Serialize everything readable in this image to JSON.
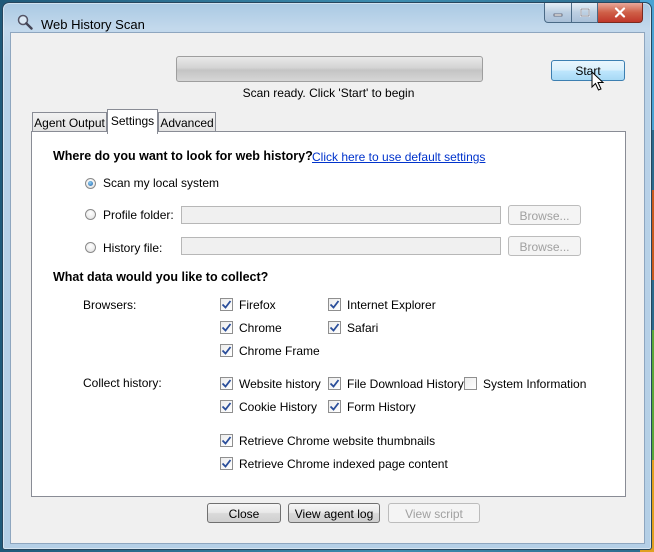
{
  "window": {
    "title": "Web History Scan"
  },
  "top": {
    "start_label": "Start",
    "status": "Scan ready.  Click 'Start' to begin",
    "progress": 0
  },
  "tabs": [
    "Agent Output",
    "Settings",
    "Advanced"
  ],
  "settings": {
    "where_heading": "Where do you want to look for web history?",
    "default_link": "Click here to use default settings",
    "sources": {
      "local": "Scan my local system",
      "profile": "Profile folder:",
      "history": "History file:",
      "profile_value": "",
      "history_value": "",
      "browse1": "Browse...",
      "browse2": "Browse..."
    },
    "collect_heading": "What data would you like to collect?",
    "browsers_label": "Browsers:",
    "browsers": {
      "firefox": "Firefox",
      "chrome": "Chrome",
      "chrome_frame": "Chrome Frame",
      "ie": "Internet Explorer",
      "safari": "Safari"
    },
    "collect_label": "Collect history:",
    "collect": {
      "website": "Website history",
      "file_download": "File Download History",
      "system_info": "System Information",
      "cookie": "Cookie History",
      "form": "Form History",
      "thumbnails": "Retrieve Chrome website thumbnails",
      "indexed": "Retrieve Chrome indexed page content"
    }
  },
  "bottom": {
    "close": "Close",
    "view_log": "View agent log",
    "view_script": "View script"
  }
}
